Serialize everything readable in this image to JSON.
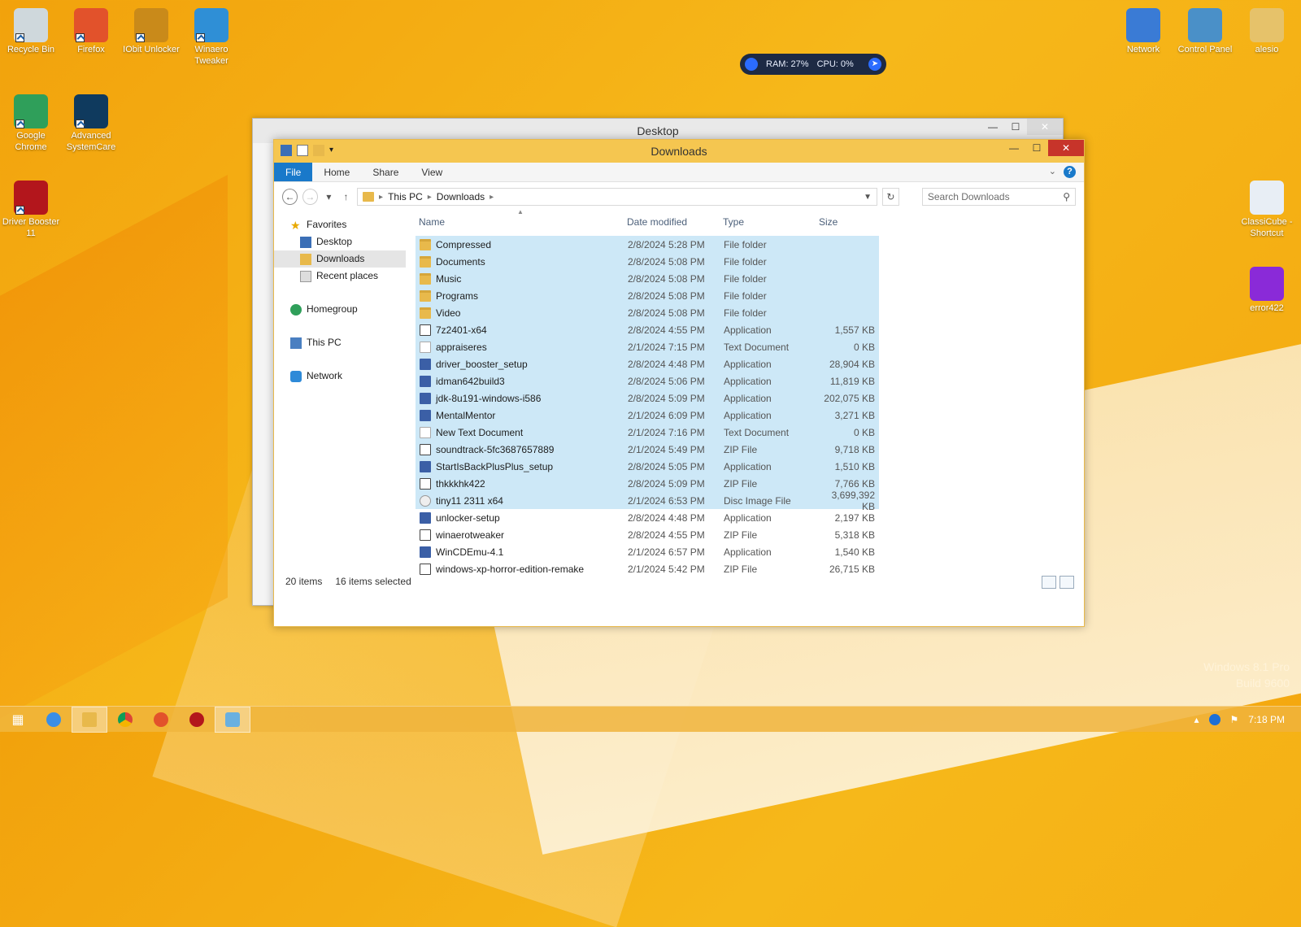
{
  "desktop": {
    "icons_left": [
      {
        "label": "Recycle Bin",
        "icon": "recycle-bin-icon",
        "color": "#cfd8dc"
      },
      {
        "label": "Firefox",
        "icon": "firefox-icon",
        "color": "#e2522b"
      },
      {
        "label": "IObit Unlocker",
        "icon": "unlocker-icon",
        "color": "#c98a1a"
      },
      {
        "label": "Winaero Tweaker",
        "icon": "winaero-icon",
        "color": "#2f8fd6"
      },
      {
        "label": "Google Chrome",
        "icon": "chrome-icon",
        "color": "#2f9f5a"
      },
      {
        "label": "Advanced SystemCare",
        "icon": "systemcare-icon",
        "color": "#0f3a5e"
      },
      {
        "label": "Driver Booster 11",
        "icon": "driver-booster-icon",
        "color": "#b3161c"
      }
    ],
    "icons_right": [
      {
        "label": "Network",
        "icon": "network-icon",
        "color": "#3a7bd5"
      },
      {
        "label": "Control Panel",
        "icon": "control-panel-icon",
        "color": "#4a90c8"
      },
      {
        "label": "alesio",
        "icon": "user-folder-icon",
        "color": "#e6c26a"
      },
      {
        "label": "ClassiCube - Shortcut",
        "icon": "classicube-icon",
        "color": "#e8eef5"
      },
      {
        "label": "error422",
        "icon": "cube-icon",
        "color": "#8a2ad8"
      }
    ],
    "watermark": {
      "line1": "Windows 8.1 Pro",
      "line2": "Build 9600"
    }
  },
  "widget": {
    "ram": "RAM: 27%",
    "cpu": "CPU: 0%"
  },
  "back_window": {
    "title": "Desktop"
  },
  "window": {
    "title": "Downloads",
    "ribbon_tabs": [
      "File",
      "Home",
      "Share",
      "View"
    ],
    "breadcrumb": [
      "This PC",
      "Downloads"
    ],
    "search_placeholder": "Search Downloads",
    "nav": {
      "favorites": "Favorites",
      "desktop": "Desktop",
      "downloads": "Downloads",
      "recent": "Recent places",
      "homegroup": "Homegroup",
      "thispc": "This PC",
      "network": "Network"
    },
    "columns": {
      "name": "Name",
      "date": "Date modified",
      "type": "Type",
      "size": "Size"
    },
    "files": [
      {
        "name": "Compressed",
        "date": "2/8/2024 5:28 PM",
        "type": "File folder",
        "size": "",
        "kind": "folder",
        "selected": true
      },
      {
        "name": "Documents",
        "date": "2/8/2024 5:08 PM",
        "type": "File folder",
        "size": "",
        "kind": "folder",
        "selected": true
      },
      {
        "name": "Music",
        "date": "2/8/2024 5:08 PM",
        "type": "File folder",
        "size": "",
        "kind": "folder",
        "selected": true
      },
      {
        "name": "Programs",
        "date": "2/8/2024 5:08 PM",
        "type": "File folder",
        "size": "",
        "kind": "folder",
        "selected": true
      },
      {
        "name": "Video",
        "date": "2/8/2024 5:08 PM",
        "type": "File folder",
        "size": "",
        "kind": "folder",
        "selected": true
      },
      {
        "name": "7z2401-x64",
        "date": "2/8/2024 4:55 PM",
        "type": "Application",
        "size": "1,557 KB",
        "kind": "zip",
        "selected": true
      },
      {
        "name": "appraiseres",
        "date": "2/1/2024 7:15 PM",
        "type": "Text Document",
        "size": "0 KB",
        "kind": "txt",
        "selected": true
      },
      {
        "name": "driver_booster_setup",
        "date": "2/8/2024 4:48 PM",
        "type": "Application",
        "size": "28,904 KB",
        "kind": "app",
        "selected": true
      },
      {
        "name": "idman642build3",
        "date": "2/8/2024 5:06 PM",
        "type": "Application",
        "size": "11,819 KB",
        "kind": "app",
        "selected": true
      },
      {
        "name": "jdk-8u191-windows-i586",
        "date": "2/8/2024 5:09 PM",
        "type": "Application",
        "size": "202,075 KB",
        "kind": "app",
        "selected": true
      },
      {
        "name": "MentalMentor",
        "date": "2/1/2024 6:09 PM",
        "type": "Application",
        "size": "3,271 KB",
        "kind": "app",
        "selected": true
      },
      {
        "name": "New Text Document",
        "date": "2/1/2024 7:16 PM",
        "type": "Text Document",
        "size": "0 KB",
        "kind": "txt",
        "selected": true
      },
      {
        "name": "soundtrack-5fc3687657889",
        "date": "2/1/2024 5:49 PM",
        "type": "ZIP File",
        "size": "9,718 KB",
        "kind": "zip",
        "selected": true
      },
      {
        "name": "StartIsBackPlusPlus_setup",
        "date": "2/8/2024 5:05 PM",
        "type": "Application",
        "size": "1,510 KB",
        "kind": "app",
        "selected": true
      },
      {
        "name": "thkkkhk422",
        "date": "2/8/2024 5:09 PM",
        "type": "ZIP File",
        "size": "7,766 KB",
        "kind": "zip",
        "selected": true
      },
      {
        "name": "tiny11 2311 x64",
        "date": "2/1/2024 6:53 PM",
        "type": "Disc Image File",
        "size": "3,699,392 KB",
        "kind": "iso",
        "selected": true
      },
      {
        "name": "unlocker-setup",
        "date": "2/8/2024 4:48 PM",
        "type": "Application",
        "size": "2,197 KB",
        "kind": "app",
        "selected": false
      },
      {
        "name": "winaerotweaker",
        "date": "2/8/2024 4:55 PM",
        "type": "ZIP File",
        "size": "5,318 KB",
        "kind": "zip",
        "selected": false
      },
      {
        "name": "WinCDEmu-4.1",
        "date": "2/1/2024 6:57 PM",
        "type": "Application",
        "size": "1,540 KB",
        "kind": "app",
        "selected": false
      },
      {
        "name": "windows-xp-horror-edition-remake",
        "date": "2/1/2024 5:42 PM",
        "type": "ZIP File",
        "size": "26,715 KB",
        "kind": "zip",
        "selected": false
      }
    ],
    "status": {
      "count": "20 items",
      "selected": "16 items selected"
    }
  },
  "taskbar": {
    "clock": "7:18 PM"
  }
}
